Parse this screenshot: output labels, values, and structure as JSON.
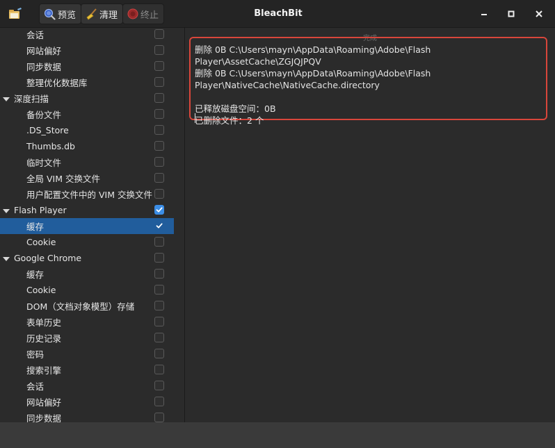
{
  "window": {
    "title": "BleachBit"
  },
  "toolbar": {
    "preview_label": "预览",
    "clean_label": "清理",
    "stop_label": "终止"
  },
  "tree": [
    {
      "label": "会话",
      "level": "child",
      "checked": false
    },
    {
      "label": "网站偏好",
      "level": "child",
      "checked": false
    },
    {
      "label": "同步数据",
      "level": "child",
      "checked": false
    },
    {
      "label": "整理优化数据库",
      "level": "child",
      "checked": false
    },
    {
      "label": "深度扫描",
      "level": "parent",
      "checked": false
    },
    {
      "label": "备份文件",
      "level": "child",
      "checked": false
    },
    {
      "label": ".DS_Store",
      "level": "child",
      "checked": false
    },
    {
      "label": "Thumbs.db",
      "level": "child",
      "checked": false
    },
    {
      "label": "临时文件",
      "level": "child",
      "checked": false
    },
    {
      "label": "全局 VIM 交换文件",
      "level": "child",
      "checked": false
    },
    {
      "label": "用户配置文件中的 VIM 交换文件",
      "level": "child",
      "checked": false
    },
    {
      "label": "Flash Player",
      "level": "parent",
      "checked": true
    },
    {
      "label": "缓存",
      "level": "child",
      "checked": true,
      "selected": true
    },
    {
      "label": "Cookie",
      "level": "child",
      "checked": false
    },
    {
      "label": "Google Chrome",
      "level": "parent",
      "checked": false
    },
    {
      "label": "缓存",
      "level": "child",
      "checked": false
    },
    {
      "label": "Cookie",
      "level": "child",
      "checked": false
    },
    {
      "label": "DOM（文档对象模型）存储",
      "level": "child",
      "checked": false
    },
    {
      "label": "表单历史",
      "level": "child",
      "checked": false
    },
    {
      "label": "历史记录",
      "level": "child",
      "checked": false
    },
    {
      "label": "密码",
      "level": "child",
      "checked": false
    },
    {
      "label": "搜索引擎",
      "level": "child",
      "checked": false
    },
    {
      "label": "会话",
      "level": "child",
      "checked": false
    },
    {
      "label": "网站偏好",
      "level": "child",
      "checked": false
    },
    {
      "label": "同步数据",
      "level": "child",
      "checked": false
    }
  ],
  "output": {
    "ghost_title": "完成",
    "lines": [
      "删除 0B C:\\Users\\mayn\\AppData\\Roaming\\Adobe\\Flash Player\\AssetCache\\ZGJQJPQV",
      "删除 0B C:\\Users\\mayn\\AppData\\Roaming\\Adobe\\Flash",
      "Player\\NativeCache\\NativeCache.directory",
      "",
      "已释放磁盘空间：0B",
      "已删除文件：2 个"
    ]
  },
  "colors": {
    "selection": "#215d9c",
    "checkbox_on": "#3c8ee6",
    "highlight_border": "#d9463b"
  },
  "icons": {
    "app": "bleachbit-app-icon",
    "preview": "magnifier-preview-icon",
    "clean": "broom-clean-icon",
    "stop": "stop-icon",
    "expander": "triangle-down-icon",
    "window_minimize": "minimize-icon",
    "window_maximize": "maximize-icon",
    "window_close": "close-icon"
  }
}
